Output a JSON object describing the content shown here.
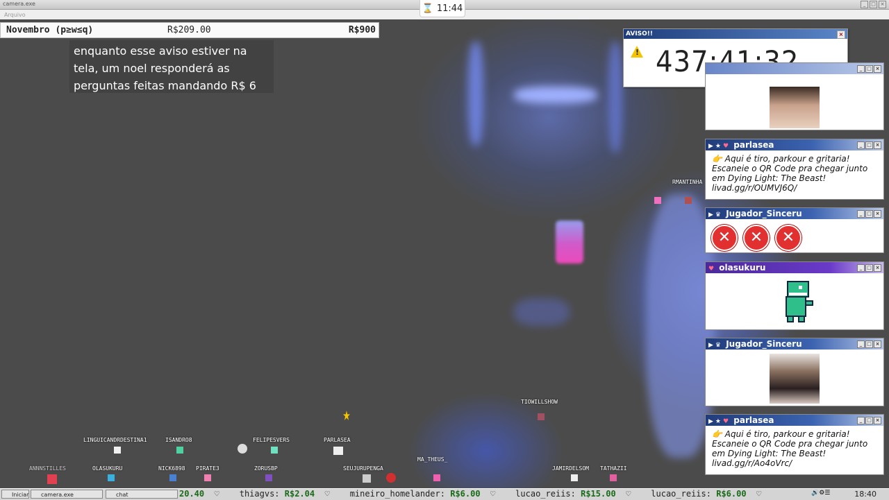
{
  "window": {
    "title": "camera.exe",
    "menu": "Arquivo"
  },
  "top_clock": {
    "time": "11:44"
  },
  "goal_bar": {
    "label": "Novembro (p≥w≤q)",
    "current": "R$209.00",
    "target": "R$900"
  },
  "notice": {
    "text": "enquanto esse aviso estiver na tela, um noel responderá as perguntas feitas mandando R$ 6"
  },
  "aviso": {
    "title": "AVISO!!",
    "timer": "437:41:32"
  },
  "panels": [
    {
      "title": "",
      "type": "cam"
    },
    {
      "title": "parlasea",
      "type": "message",
      "color": "blue",
      "lines": [
        "👉 Aqui é tiro, parkour e gritaria!",
        "Escaneie o QR Code pra chegar junto",
        "em Dying Light: The Beast!",
        "livad.gg/r/OUMVJ6Q/"
      ]
    },
    {
      "title": "Jugador_Sinceru",
      "type": "crosses",
      "color": "blue"
    },
    {
      "title": "olasukuru",
      "type": "dino",
      "color": "purple"
    },
    {
      "title": "Jugador_Sinceru",
      "type": "cam",
      "color": "blue"
    },
    {
      "title": "parlasea",
      "type": "message",
      "color": "blue",
      "lines": [
        "👉 Aqui é tiro, parkour e gritaria!",
        "Escaneie o QR Code pra chegar junto",
        "em Dying Light: The Beast!",
        "livad.gg/r/Ao4oVrc/"
      ]
    }
  ],
  "avatars": [
    {
      "name": "LINGUICANDRDESTINA1"
    },
    {
      "name": "ISANDRO8"
    },
    {
      "name": "FELIPESVERS"
    },
    {
      "name": "PARLASEA"
    },
    {
      "name": "ANNNSTILLES"
    },
    {
      "name": "OLASUKURU"
    },
    {
      "name": "NICK6898"
    },
    {
      "name": "PIRATE3"
    },
    {
      "name": "ZORUSBP"
    },
    {
      "name": "SEUJURUPENGA"
    },
    {
      "name": "MA_THEUS_"
    },
    {
      "name": "TIOWILLSHOW"
    },
    {
      "name": "RMANTINHA"
    },
    {
      "name": "JAMIRDELSOM"
    },
    {
      "name": "TATHAZII"
    }
  ],
  "taskbar": {
    "start": "Iniciar",
    "task1": "camera.exe",
    "task2": "chat",
    "clock": "18:40"
  },
  "ticker": [
    {
      "name": "",
      "amount": "20.40"
    },
    {
      "name": "thiagvs:",
      "amount": "R$2.04"
    },
    {
      "name": "mineiro_homelander:",
      "amount": "R$6.00"
    },
    {
      "name": "lucao_reiis:",
      "amount": "R$15.00"
    },
    {
      "name": "lucao_reiis:",
      "amount": "R$6.00"
    }
  ],
  "colors": {
    "title_blue": "#213c7a",
    "title_purple": "#4a2a9a",
    "cross_red": "#e23030",
    "timer_text": "#222222"
  }
}
